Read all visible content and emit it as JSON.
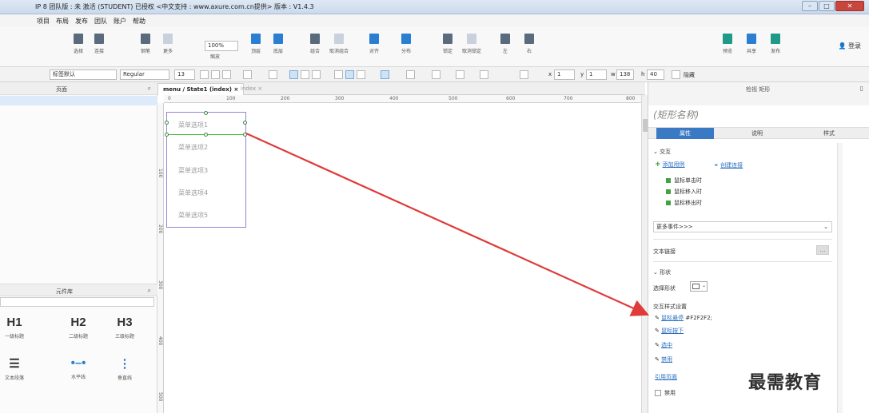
{
  "window": {
    "title": "IP 8 团队版 : 未 激活 (STUDENT) 已授权   <中文支持 : www.axure.com.cn提供> 版本 : V1.4.3"
  },
  "menu": [
    "项目",
    "布局",
    "发布",
    "团队",
    "账户",
    "帮助"
  ],
  "toolbar": {
    "items": [
      {
        "label": "选择"
      },
      {
        "label": "连接"
      },
      {
        "label": "钢笔"
      },
      {
        "label": "更多"
      },
      {
        "label": "缩放"
      },
      {
        "label": "顶层"
      },
      {
        "label": "底层"
      },
      {
        "label": "组合"
      },
      {
        "label": "取消组合"
      },
      {
        "label": "对齐"
      },
      {
        "label": "分布"
      },
      {
        "label": "锁定"
      },
      {
        "label": "取消锁定"
      },
      {
        "label": "左"
      },
      {
        "label": "右"
      },
      {
        "label": "预览"
      },
      {
        "label": "共享"
      },
      {
        "label": "发布"
      }
    ],
    "zoom": "100%",
    "login": "登录"
  },
  "format": {
    "style": "标签默认",
    "font_weight": "Regular",
    "font_size": "13",
    "x_label": "x",
    "x_value": "1",
    "y_label": "y",
    "y_value": "1",
    "w_label": "w",
    "w_value": "138",
    "h_label": "h",
    "h_value": "40",
    "hidden_label": "隐藏"
  },
  "left_panel": {
    "pages_title": "页面",
    "library_title": "元件库",
    "widgets": [
      {
        "big": "H1",
        "label": "一级标题"
      },
      {
        "big": "H2",
        "label": "二级标题"
      },
      {
        "big": "H3",
        "label": "三级标题"
      },
      {
        "big": "",
        "label": "文本段落"
      },
      {
        "big": "",
        "label": "水平线"
      },
      {
        "big": "",
        "label": "垂直线"
      }
    ]
  },
  "canvas": {
    "tabs": [
      {
        "label": "menu / State1 (index)",
        "active": true
      },
      {
        "label": "index",
        "active": false
      }
    ],
    "ruler_top": [
      "0",
      "100",
      "200",
      "300",
      "400",
      "500",
      "600",
      "700",
      "800"
    ],
    "ruler_left": [
      "100",
      "200",
      "300",
      "400",
      "500"
    ],
    "menu_items": [
      "菜单选项1",
      "菜单选项2",
      "菜单选项3",
      "菜单选项4",
      "菜单选项5"
    ]
  },
  "inspector": {
    "header": "检视 矩形",
    "name_placeholder": "(矩形名称)",
    "tabs": [
      "属性",
      "说明",
      "样式"
    ],
    "interaction_title": "交互",
    "add_case": "添加用例",
    "create_link": "创建连接",
    "events": [
      "鼠标单击时",
      "鼠标移入时",
      "鼠标移出时"
    ],
    "more_events": "更多事件>>>",
    "text_link": "文本链接",
    "shape_title": "形状",
    "select_shape": "选择形状",
    "interaction_styles": "交互样式设置",
    "hover_link": "鼠标悬停",
    "hover_value": "#F2F2F2;",
    "mouse_down": "鼠标按下",
    "selected": "选中",
    "disabled": "禁用",
    "ref_page": "引用页面",
    "disabled_check": "禁用"
  },
  "watermark": "最需教育",
  "colors": {
    "accent": "#3a79c4",
    "arrow": "#e03a3a",
    "selection": "#3dbb3d",
    "widget_border": "#8f86d6"
  }
}
